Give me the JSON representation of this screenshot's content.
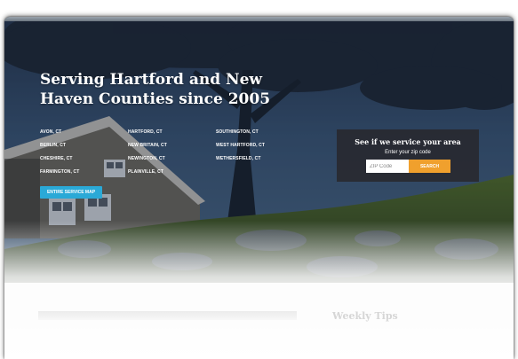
{
  "hero": {
    "title": "Serving Hartford and New Haven Counties since 2005",
    "towns": [
      "AVON, CT",
      "HARTFORD, CT",
      "SOUTHINGTON, CT",
      "BERLIN, CT",
      "NEW BRITAIN, CT",
      "WEST HARTFORD, CT",
      "CHESHIRE, CT",
      "NEWINGTON, CT",
      "WETHERSFIELD, CT",
      "FARMINGTON, CT",
      "PLAINVILLE, CT",
      ""
    ],
    "map_button_label": "ENTIRE SERVICE MAP"
  },
  "zip_panel": {
    "heading": "See if we service your area",
    "subheading": "Enter your zip code",
    "input_placeholder": "ZIP Code",
    "input_value": "",
    "search_label": "SEARCH"
  },
  "below": {
    "weekly_heading": "Weekly Tips"
  },
  "colors": {
    "accent_blue": "#2aa9d7",
    "search_orange": "#f0a02d",
    "panel_dark": "#28282e"
  }
}
